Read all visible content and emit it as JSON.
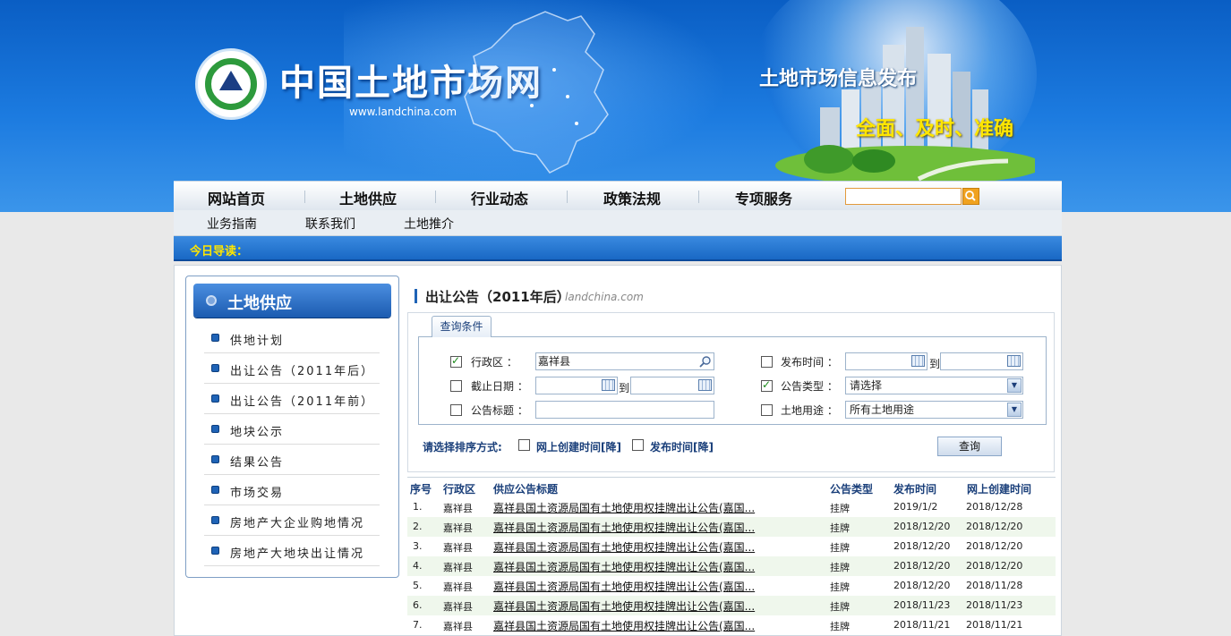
{
  "banner": {
    "site_name": "中国土地市场网",
    "site_url": "www.landchina.com",
    "slogan1": "土地市场信息发布",
    "slogan2": "全面、及时、准确"
  },
  "nav_main": [
    "网站首页",
    "土地供应",
    "行业动态",
    "政策法规",
    "专项服务"
  ],
  "search": {
    "value": "",
    "placeholder": ""
  },
  "nav_sub": [
    "业务指南",
    "联系我们",
    "土地推介"
  ],
  "guide_label": "今日导读：",
  "sidebar": {
    "title": "土地供应",
    "items": [
      "供地计划",
      "出让公告（2011年后）",
      "出让公告（2011年前）",
      "地块公示",
      "结果公告",
      "市场交易",
      "房地产大企业购地情况",
      "房地产大地块出让情况"
    ]
  },
  "main": {
    "title": "出让公告（2011年后）",
    "subtitle": "landchina.com"
  },
  "query": {
    "tab": "查询条件",
    "region_label": "行政区 ：",
    "region_value": "嘉祥县",
    "region_checked": true,
    "pubtime_label": "发布时间 ：",
    "pubtime_checked": false,
    "deadline_label": "截止日期 ：",
    "deadline_checked": false,
    "to1": "到",
    "to2": "到",
    "type_label": "公告类型 ：",
    "type_checked": true,
    "type_value": "请选择",
    "title_label": "公告标题 ：",
    "title_checked": false,
    "title_value": "",
    "use_label": "土地用途 ：",
    "use_checked": false,
    "use_value": "所有土地用途",
    "sort_label": "请选择排序方式:",
    "sort_opt1": "网上创建时间[降]",
    "sort_opt2": "发布时间[降]",
    "button": "查询"
  },
  "table": {
    "headers": [
      "序号",
      "行政区",
      "供应公告标题",
      "公告类型",
      "发布时间",
      "网上创建时间"
    ],
    "rows": [
      [
        "1.",
        "嘉祥县",
        "嘉祥县国土资源局国有土地使用权挂牌出让公告(嘉国...",
        "挂牌",
        "2019/1/2",
        "2018/12/28"
      ],
      [
        "2.",
        "嘉祥县",
        "嘉祥县国土资源局国有土地使用权挂牌出让公告(嘉国...",
        "挂牌",
        "2018/12/20",
        "2018/12/20"
      ],
      [
        "3.",
        "嘉祥县",
        "嘉祥县国土资源局国有土地使用权挂牌出让公告(嘉国...",
        "挂牌",
        "2018/12/20",
        "2018/12/20"
      ],
      [
        "4.",
        "嘉祥县",
        "嘉祥县国土资源局国有土地使用权挂牌出让公告(嘉国...",
        "挂牌",
        "2018/12/20",
        "2018/12/20"
      ],
      [
        "5.",
        "嘉祥县",
        "嘉祥县国土资源局国有土地使用权挂牌出让公告(嘉国...",
        "挂牌",
        "2018/12/20",
        "2018/11/28"
      ],
      [
        "6.",
        "嘉祥县",
        "嘉祥县国土资源局国有土地使用权挂牌出让公告(嘉国...",
        "挂牌",
        "2018/11/23",
        "2018/11/23"
      ],
      [
        "7.",
        "嘉祥县",
        "嘉祥县国土资源局国有土地使用权挂牌出让公告(嘉国...",
        "挂牌",
        "2018/11/21",
        "2018/11/21"
      ]
    ]
  },
  "colors": {
    "brand_blue": "#1f63b6",
    "accent_yellow": "#ffe600",
    "row_alt": "#eff7ec"
  }
}
